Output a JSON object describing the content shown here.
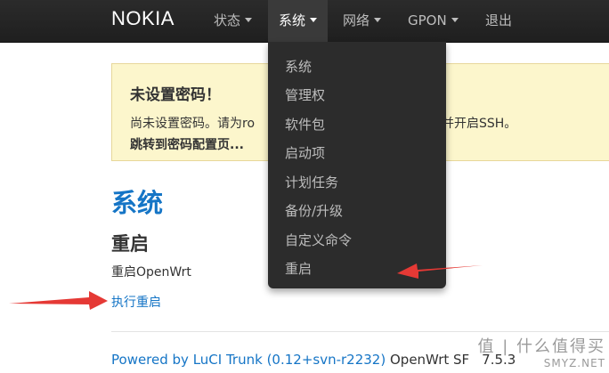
{
  "navbar": {
    "brand": "NOKIA",
    "items": [
      {
        "label": "状态",
        "has_caret": true
      },
      {
        "label": "系统",
        "has_caret": true,
        "active": true
      },
      {
        "label": "网络",
        "has_caret": true
      },
      {
        "label": "GPON",
        "has_caret": true
      },
      {
        "label": "退出",
        "has_caret": false
      }
    ]
  },
  "dropdown": {
    "items": [
      "系统",
      "管理权",
      "软件包",
      "启动项",
      "计划任务",
      "备份/升级",
      "自定义命令",
      "重启"
    ]
  },
  "alert": {
    "title": "未设置密码！",
    "line_left": "尚未设置密码。请为ro",
    "line_right": "并开启SSH。",
    "link": "跳转到密码配置页..."
  },
  "main": {
    "page_title": "系统",
    "section_title": "重启",
    "section_desc": "重启OpenWrt",
    "action_link": "执行重启"
  },
  "footer": {
    "link": "Powered by LuCI Trunk (0.12+svn-r2232)",
    "text": "OpenWrt SF",
    "text_tail": "7.5.3"
  },
  "watermark": {
    "top": "值 | 什么值得买",
    "bottom": "SMYZ.NET"
  },
  "colors": {
    "navbar": "#222222",
    "accent": "#1575c6",
    "alert_bg": "#fcf6cc",
    "arrow": "#e53935"
  }
}
